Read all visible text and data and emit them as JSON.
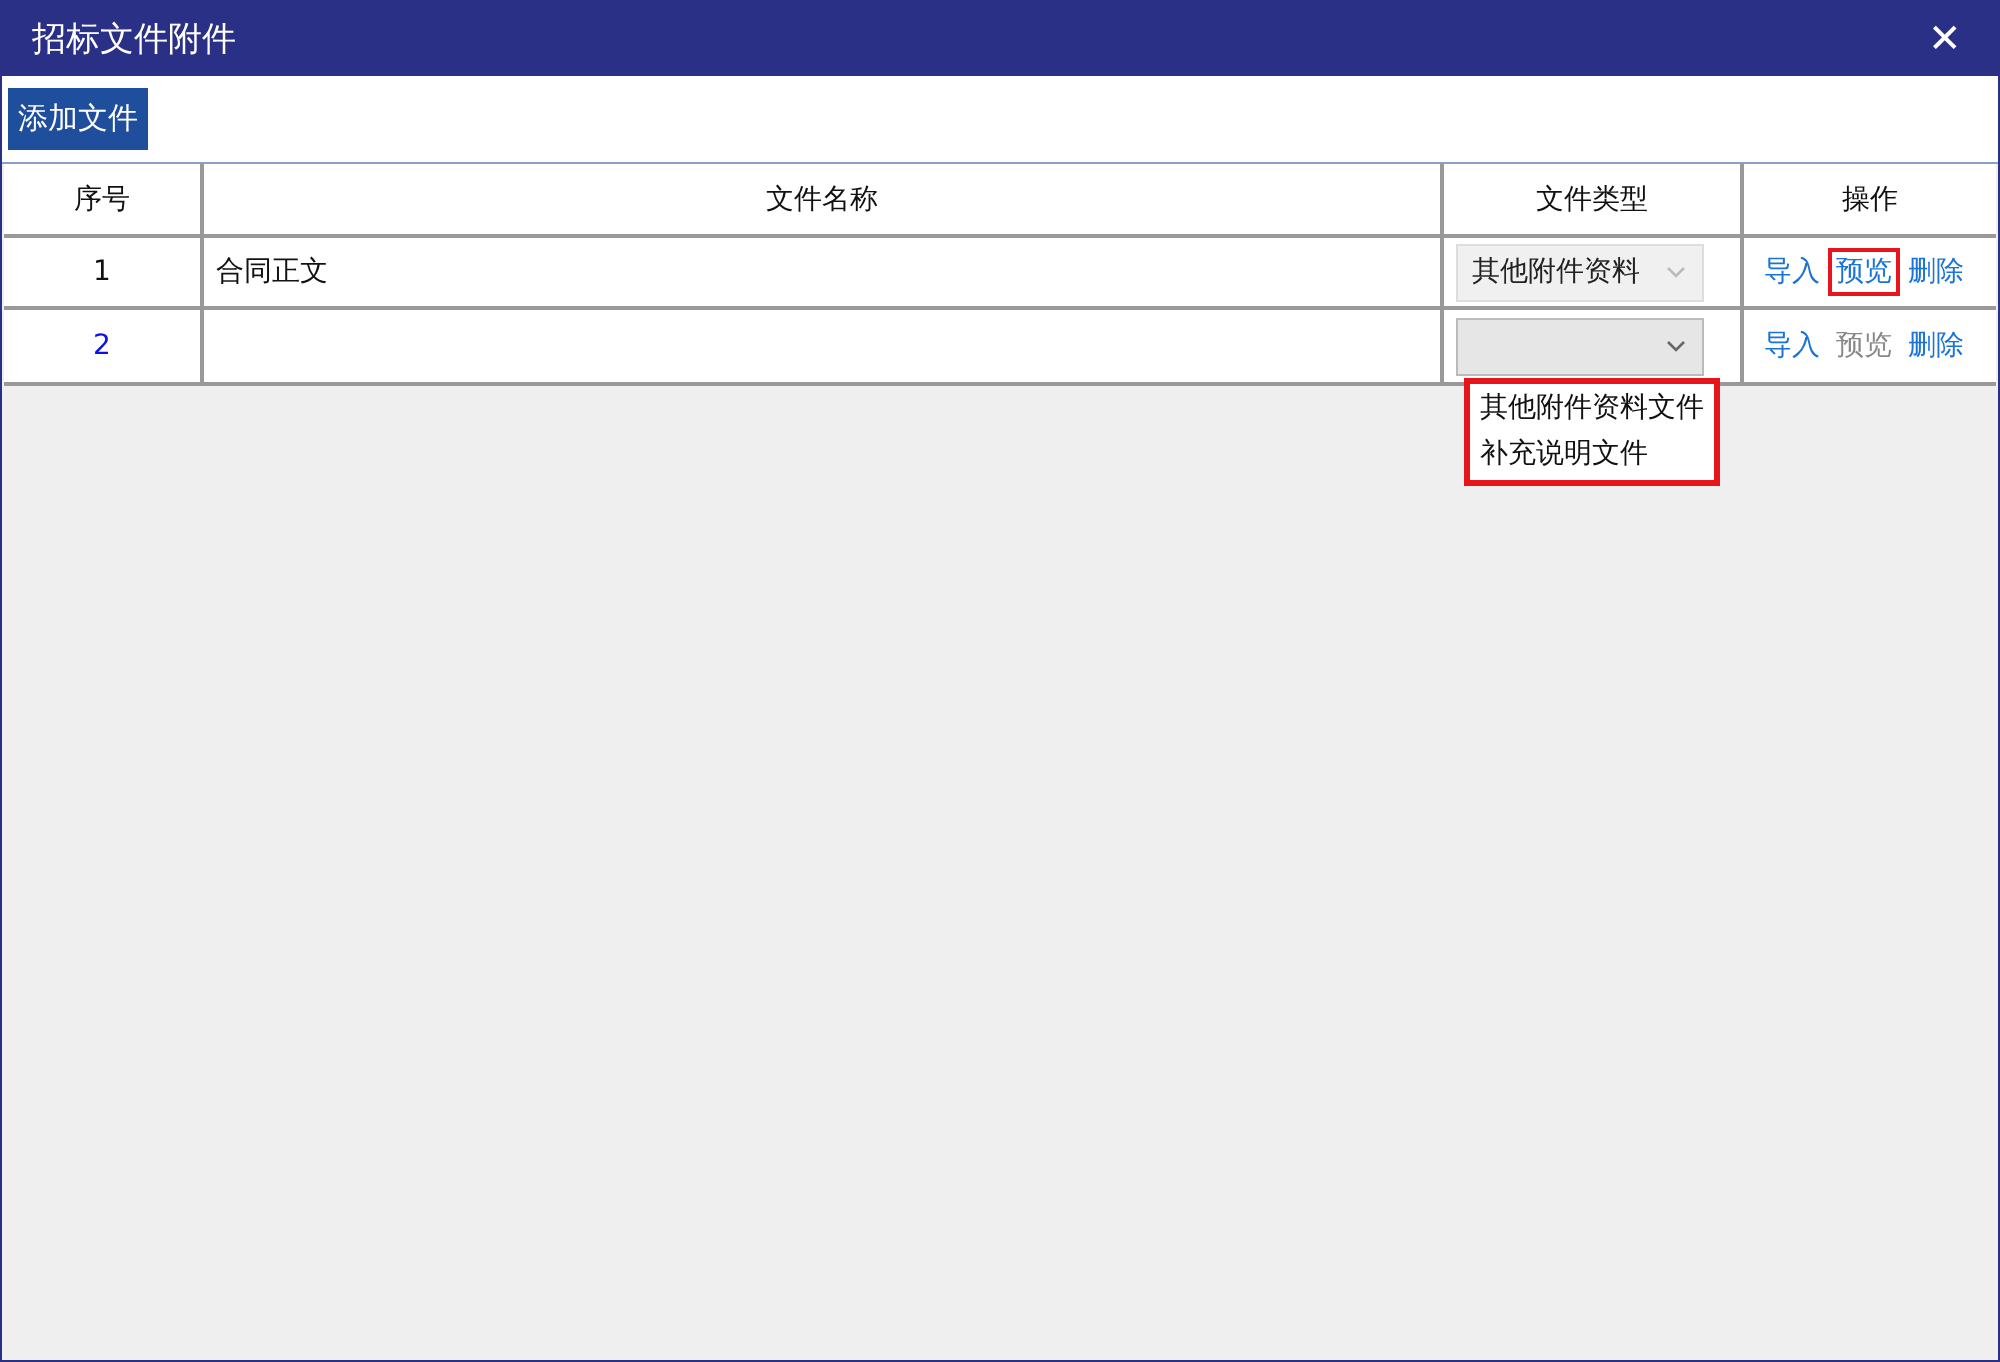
{
  "window": {
    "title": "招标文件附件",
    "close": "✕"
  },
  "toolbar": {
    "button": "添加文件"
  },
  "table": {
    "columns": [
      "序号",
      "文件名称",
      "文件类型",
      "操作"
    ],
    "rows": [
      {
        "index": "1",
        "selected": false,
        "name": "合同正文",
        "type": {
          "value": "其他附件资料",
          "disabled": true
        },
        "actions": [
          {
            "label": "导入",
            "disabled": false,
            "highlighted": false
          },
          {
            "label": "预览",
            "disabled": false,
            "highlighted": true
          },
          {
            "label": "删除",
            "disabled": false,
            "highlighted": false
          }
        ]
      },
      {
        "index": "2",
        "selected": true,
        "type": {
          "disabled": false,
          "options": [
            "其他附件资料文件",
            "补充说明文件"
          ],
          "highlighted": true
        },
        "actions": [
          {
            "label": "导入",
            "disabled": false,
            "highlighted": false
          },
          {
            "label": "预览",
            "disabled": true,
            "highlighted": false
          },
          {
            "label": "删除",
            "disabled": false,
            "highlighted": false
          }
        ]
      }
    ]
  }
}
